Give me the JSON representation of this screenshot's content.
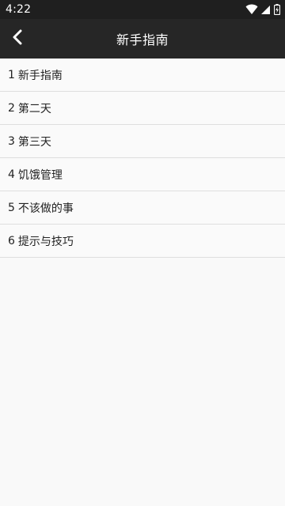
{
  "status_bar": {
    "time": "4:22",
    "icons": [
      "wifi-icon",
      "signal-icon",
      "battery-icon"
    ]
  },
  "app_bar": {
    "title": "新手指南",
    "back_icon": "chevron-left-icon"
  },
  "colors": {
    "status_bar_bg": "#1f1f1f",
    "app_bar_bg": "#262626",
    "list_bg": "#fafafa",
    "divider": "#dedede",
    "text": "#222222"
  },
  "guide_items": [
    {
      "number": "1",
      "label": "新手指南"
    },
    {
      "number": "2",
      "label": "第二天"
    },
    {
      "number": "3",
      "label": "第三天"
    },
    {
      "number": "4",
      "label": "饥饿管理"
    },
    {
      "number": "5",
      "label": "不该做的事"
    },
    {
      "number": "6",
      "label": "提示与技巧"
    }
  ]
}
